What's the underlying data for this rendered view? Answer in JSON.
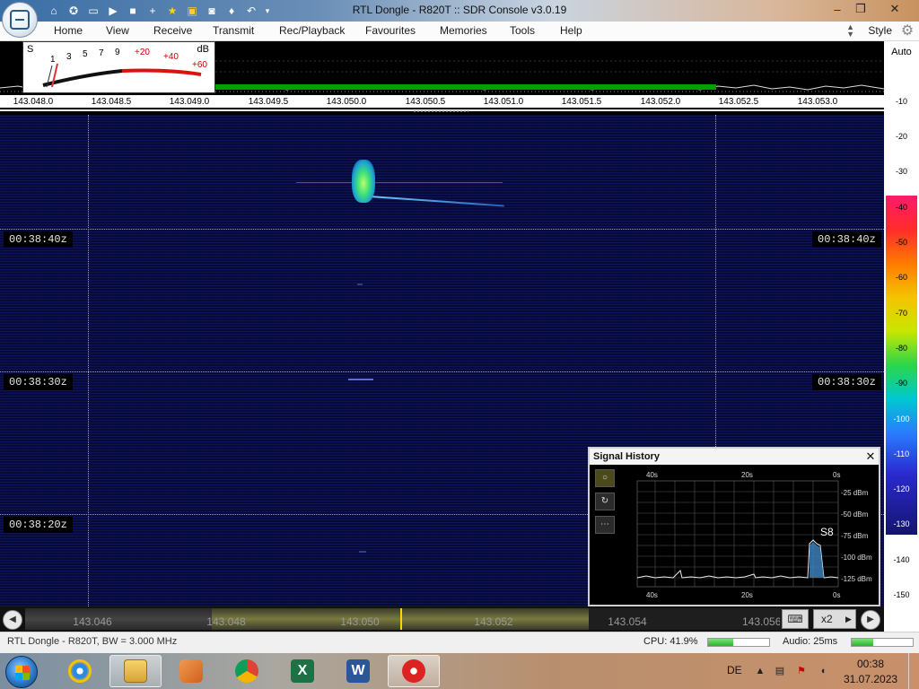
{
  "window": {
    "title": "RTL Dongle - R820T :: SDR Console v3.0.19",
    "controls": [
      "minimize",
      "maximize",
      "close"
    ]
  },
  "quick_access_icons": [
    "home-icon",
    "help-lifebuoy-icon",
    "folder-icon",
    "play-icon",
    "stop-icon",
    "plus-icon",
    "star-icon",
    "lock-icon",
    "camera-icon",
    "droplet-icon",
    "undo-icon",
    "dropdown-icon"
  ],
  "menu": {
    "items": [
      "Home",
      "View",
      "Receive",
      "Transmit",
      "Rec/Playback",
      "Favourites",
      "Memories",
      "Tools",
      "Help"
    ],
    "style_label": "Style"
  },
  "smeter": {
    "s_label": "S",
    "db_label": "dB",
    "s_ticks": [
      "1",
      "3",
      "5",
      "7",
      "9"
    ],
    "db_ticks": [
      "+20",
      "+40",
      "+60"
    ]
  },
  "frequency_axis": [
    "143.048.0",
    "143.048.5",
    "143.049.0",
    "143.049.5",
    "143.050.0",
    "143.050.5",
    "143.051.0",
    "143.051.5",
    "143.052.0",
    "143.052.5",
    "143.053.0"
  ],
  "waterfall": {
    "timestamps": [
      "00:38:40z",
      "00:38:30z",
      "00:38:20z"
    ]
  },
  "db_scale": {
    "auto_label": "Auto",
    "levels": [
      "-10",
      "-20",
      "-30",
      "-40",
      "-50",
      "-60",
      "-70",
      "-80",
      "-90",
      "-100",
      "-110",
      "-120",
      "-130",
      "-140",
      "-150"
    ]
  },
  "scroll": {
    "labels": [
      "143.046",
      "143.048",
      "143.050",
      "143.052",
      "143.054",
      "143.056"
    ],
    "zoom_label": "x2",
    "keyboard_icon": "keyboard-icon"
  },
  "signal_history": {
    "title": "Signal History",
    "top_axis": [
      "40s",
      "20s",
      "0s"
    ],
    "bottom_axis": [
      "40s",
      "20s",
      "0s"
    ],
    "y_axis": [
      "-25 dBm",
      "-50 dBm",
      "-75 dBm",
      "-100 dBm",
      "-125 dBm"
    ],
    "s_reading": "S8",
    "tools": [
      "circle-icon",
      "refresh-icon",
      "more-icon"
    ]
  },
  "status": {
    "left": "RTL Dongle - R820T, BW = 3.000 MHz",
    "cpu": "CPU: 41.9%",
    "cpu_level": 0.419,
    "audio": "Audio: 25ms",
    "audio_level": 0.35
  },
  "taskbar": {
    "apps": [
      "internet-explorer-icon",
      "file-explorer-icon",
      "media-player-icon",
      "chrome-icon",
      "excel-icon",
      "word-icon",
      "sdr-console-icon"
    ],
    "active_app": "sdr-console-icon",
    "language": "DE",
    "time": "00:38",
    "date": "31.07.2023"
  },
  "colors": {
    "waterfall_bg": "#050a3a",
    "spectrum_green": "#00a000",
    "scroll_center": "#ffd400"
  }
}
